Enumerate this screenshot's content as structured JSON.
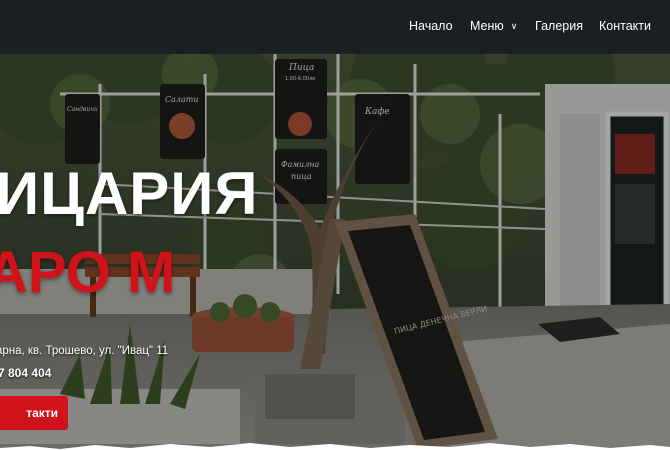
{
  "nav": {
    "items": [
      {
        "label": "Начало"
      },
      {
        "label": "Меню"
      },
      {
        "label": "Галерия"
      },
      {
        "label": "Контакти"
      }
    ]
  },
  "hero": {
    "title_line1": "ИЦАРИЯ",
    "title_line2": "АРО М",
    "address": "арна, кв. Трошево, ул. \"Ивац\" 11",
    "phone": "7 804 404",
    "cta_label": "такти",
    "signs": {
      "pizza_top": "Пица",
      "pizza_price": "1.00-6.00лв",
      "family_pizza_1": "Фамилна",
      "family_pizza_2": "пица",
      "salads": "Салати",
      "sandwiches": "Сандвичи",
      "coffee": "Кафе",
      "chalk_text": "ПИЦА ДЕНЕЧНА ВЕРЛИ"
    }
  },
  "colors": {
    "nav_bg": "#1b1e22",
    "brand_red": "#d0131a",
    "text_white": "#ffffff"
  }
}
